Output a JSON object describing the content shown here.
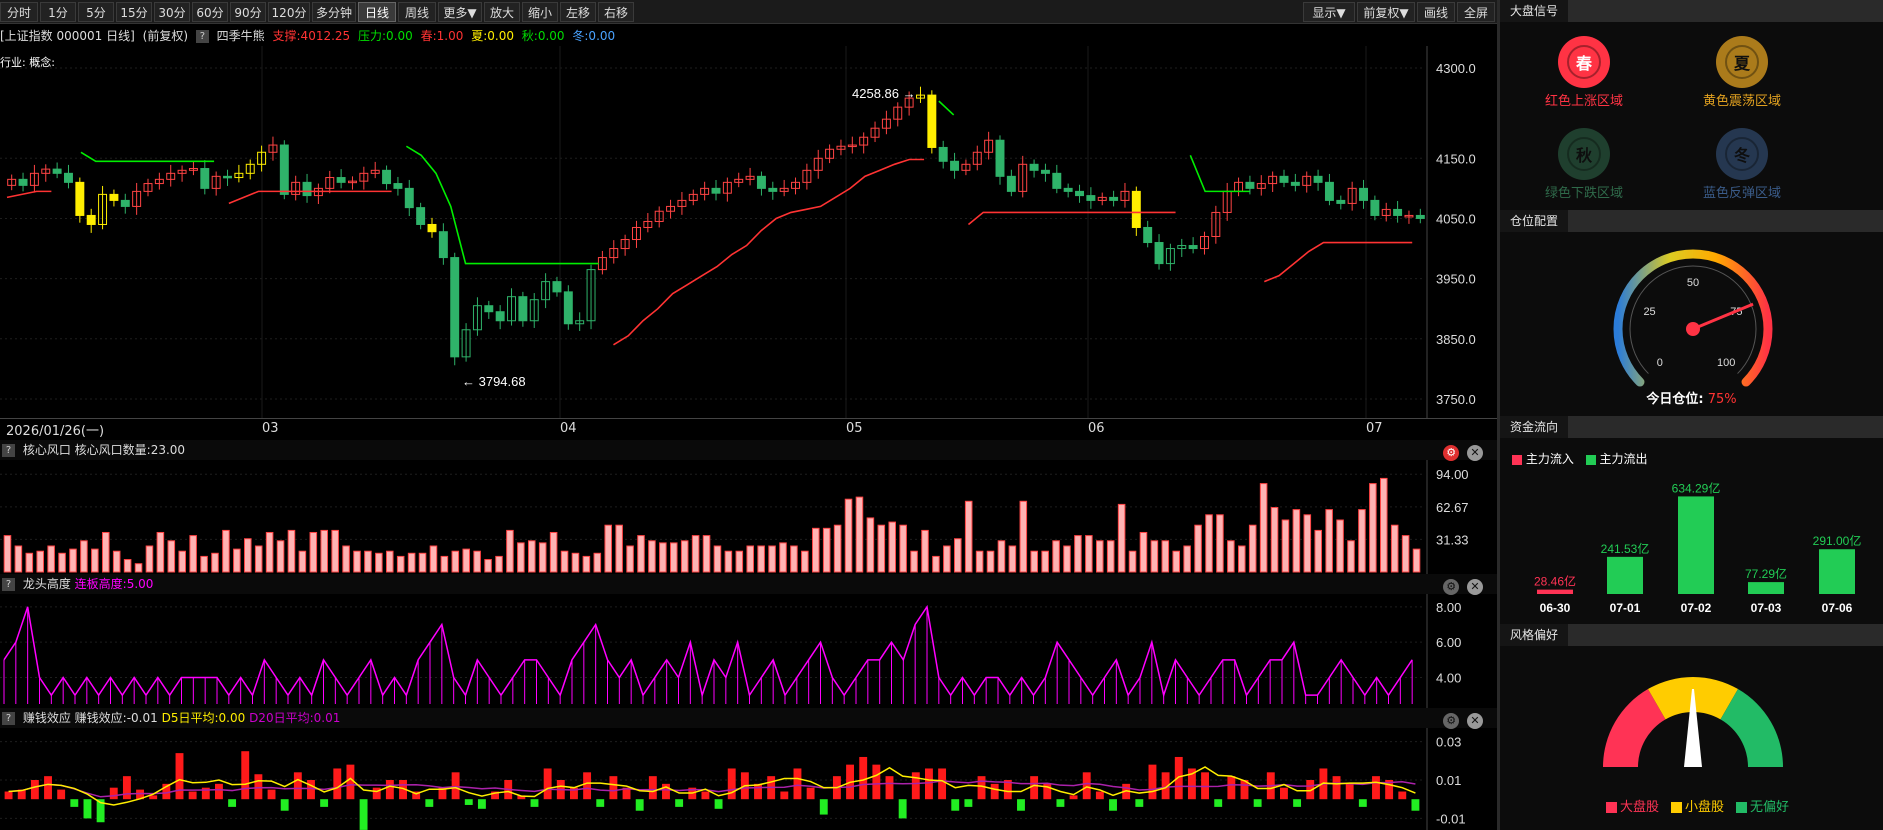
{
  "toolbar": {
    "left_buttons": [
      "分时",
      "1分",
      "5分",
      "15分",
      "30分",
      "60分",
      "90分",
      "120分",
      "多分钟",
      "日线",
      "周线",
      "更多▼",
      "放大",
      "缩小",
      "左移",
      "右移"
    ],
    "active": "日线",
    "right_buttons": [
      "显示▼",
      "前复权▼",
      "画线",
      "全屏"
    ]
  },
  "infobar": {
    "security": "[上证指数 000001 日线]",
    "adjust": "(前复权)",
    "indicator": "四季牛熊",
    "support": "支撑:4012.25",
    "pressure": "压力:0.00",
    "spring": "春:1.00",
    "summer": "夏:0.00",
    "autumn": "秋:0.00",
    "winter": "冬:0.00"
  },
  "main_chart": {
    "industry_label": "行业: 概念:",
    "y_ticks": [
      "4300.0",
      "4150.0",
      "4050.0",
      "3950.0",
      "3850.0",
      "3750.0"
    ],
    "high_label": "4258.86",
    "low_label": "3794.68",
    "date_label": "2026/01/26(一)",
    "month_labels": [
      "03",
      "04",
      "05",
      "06",
      "07"
    ]
  },
  "panel1": {
    "title": "核心风口",
    "value": "核心风口数量:23.00",
    "y_ticks": [
      "94.00",
      "62.67",
      "31.33"
    ]
  },
  "panel2": {
    "title": "龙头高度",
    "value": "连板高度:5.00",
    "y_ticks": [
      "8.00",
      "6.00",
      "4.00"
    ]
  },
  "panel3": {
    "title": "赚钱效应",
    "value": "赚钱效应:-0.01",
    "d5": "D5日平均:0.00",
    "d20": "D20日平均:0.01",
    "y_ticks": [
      "0.03",
      "0.01",
      "-0.01"
    ]
  },
  "side": {
    "market_signal": {
      "title": "大盘信号",
      "zones": [
        {
          "char": "春",
          "label": "红色上涨区域",
          "color": "#ff3344"
        },
        {
          "char": "夏",
          "label": "黄色震荡区域",
          "color": "#e0a020"
        },
        {
          "char": "秋",
          "label": "绿色下跌区域",
          "color": "#2f6a4a"
        },
        {
          "char": "冬",
          "label": "蓝色反弹区域",
          "color": "#3a5b88"
        }
      ]
    },
    "position": {
      "title": "仓位配置",
      "ticks": [
        "0",
        "25",
        "50",
        "75",
        "100"
      ],
      "today_label": "今日仓位:",
      "today_value": "75%",
      "value": 75
    },
    "capital_flow": {
      "title": "资金流向",
      "legend_in": "主力流入",
      "legend_out": "主力流出",
      "bars": [
        {
          "date": "06-30",
          "label": "28.46亿",
          "value": 28.46,
          "type": "in"
        },
        {
          "date": "07-01",
          "label": "241.53亿",
          "value": 241.53,
          "type": "out"
        },
        {
          "date": "07-02",
          "label": "634.29亿",
          "value": 634.29,
          "type": "out"
        },
        {
          "date": "07-03",
          "label": "77.29亿",
          "value": 77.29,
          "type": "out"
        },
        {
          "date": "07-06",
          "label": "291.00亿",
          "value": 291.0,
          "type": "out"
        }
      ]
    },
    "style_pref": {
      "title": "风格偏好",
      "legend": [
        "大盘股",
        "小盘股",
        "无偏好"
      ],
      "colors": [
        "#ff3355",
        "#ffcc00",
        "#22bb66"
      ]
    }
  },
  "colors": {
    "up": "#ff4444",
    "down": "#2fb36a",
    "yellow": "#ffee00",
    "magenta": "#ff00ff"
  },
  "chart_data": [
    {
      "type": "candlestick",
      "title": "四季牛熊",
      "ylim": [
        3730,
        4320
      ],
      "closes": [
        4115,
        4105,
        4125,
        4132,
        4125,
        4110,
        4055,
        4040,
        4090,
        4080,
        4070,
        4095,
        4108,
        4115,
        4125,
        4130,
        4133,
        4100,
        4120,
        4118,
        4125,
        4140,
        4160,
        4172,
        4090,
        4110,
        4088,
        4100,
        4118,
        4110,
        4112,
        4125,
        4130,
        4108,
        4100,
        4068,
        4040,
        4028,
        3985,
        3820,
        3865,
        3905,
        3895,
        3880,
        3920,
        3880,
        3915,
        3945,
        3928,
        3875,
        3880,
        3965,
        3985,
        4000,
        4015,
        4035,
        4045,
        4062,
        4070,
        4080,
        4090,
        4100,
        4092,
        4110,
        4115,
        4120,
        4100,
        4095,
        4100,
        4110,
        4130,
        4150,
        4165,
        4170,
        4172,
        4185,
        4200,
        4215,
        4235,
        4250,
        4255,
        4168,
        4145,
        4130,
        4140,
        4160,
        4180,
        4120,
        4095,
        4140,
        4130,
        4125,
        4100,
        4095,
        4088,
        4080,
        4085,
        4080,
        4095,
        4035,
        4010,
        3975,
        4000,
        4005,
        4000,
        4020,
        4060,
        4095,
        4110,
        4100,
        4108,
        4120,
        4110,
        4105,
        4120,
        4110,
        4080,
        4075,
        4100,
        4080,
        4055,
        4065,
        4055,
        4055,
        4050
      ],
      "line_segments": [
        {
          "color": "#ff3333",
          "points": [
            [
              0,
              4085
            ],
            [
              1,
              4090
            ],
            [
              2,
              4095
            ],
            [
              3,
              4095
            ]
          ]
        },
        {
          "color": "#00ee00",
          "points": [
            [
              5,
              4160
            ],
            [
              6,
              4145
            ],
            [
              7,
              4145
            ],
            [
              8,
              4145
            ],
            [
              9,
              4145
            ],
            [
              10,
              4145
            ],
            [
              11,
              4145
            ],
            [
              12,
              4145
            ],
            [
              13,
              4145
            ],
            [
              14,
              4145
            ]
          ]
        },
        {
          "color": "#ff3333",
          "points": [
            [
              15,
              4075
            ],
            [
              16,
              4085
            ],
            [
              17,
              4095
            ],
            [
              18,
              4095
            ],
            [
              19,
              4095
            ],
            [
              20,
              4095
            ],
            [
              21,
              4095
            ],
            [
              22,
              4095
            ],
            [
              23,
              4095
            ],
            [
              24,
              4095
            ],
            [
              25,
              4095
            ],
            [
              26,
              4095
            ]
          ]
        },
        {
          "color": "#00ee00",
          "points": [
            [
              27,
              4170
            ],
            [
              28,
              4155
            ],
            [
              29,
              4125
            ],
            [
              30,
              4070
            ],
            [
              31,
              3975
            ],
            [
              32,
              3975
            ],
            [
              33,
              3975
            ],
            [
              34,
              3975
            ],
            [
              35,
              3975
            ],
            [
              36,
              3975
            ],
            [
              37,
              3975
            ],
            [
              38,
              3975
            ],
            [
              39,
              3975
            ],
            [
              40,
              3975
            ]
          ]
        },
        {
          "color": "#ff3333",
          "points": [
            [
              41,
              3840
            ],
            [
              42,
              3855
            ],
            [
              43,
              3880
            ],
            [
              44,
              3900
            ],
            [
              45,
              3925
            ],
            [
              46,
              3940
            ],
            [
              47,
              3955
            ],
            [
              48,
              3970
            ],
            [
              49,
              3990
            ],
            [
              50,
              4005
            ],
            [
              51,
              4030
            ],
            [
              52,
              4050
            ],
            [
              53,
              4060
            ],
            [
              54,
              4065
            ],
            [
              55,
              4070
            ],
            [
              56,
              4085
            ],
            [
              57,
              4100
            ],
            [
              58,
              4120
            ],
            [
              59,
              4130
            ],
            [
              60,
              4140
            ],
            [
              61,
              4148
            ],
            [
              62,
              4148
            ]
          ]
        },
        {
          "color": "#00ee00",
          "points": [
            [
              63,
              4245
            ],
            [
              64,
              4222
            ]
          ]
        },
        {
          "color": "#ff3333",
          "points": [
            [
              65,
              4040
            ],
            [
              66,
              4060
            ],
            [
              67,
              4060
            ],
            [
              68,
              4060
            ],
            [
              69,
              4060
            ],
            [
              70,
              4060
            ],
            [
              71,
              4060
            ],
            [
              72,
              4060
            ],
            [
              73,
              4060
            ],
            [
              74,
              4060
            ],
            [
              75,
              4060
            ],
            [
              76,
              4060
            ],
            [
              77,
              4060
            ],
            [
              78,
              4060
            ],
            [
              79,
              4060
            ]
          ]
        },
        {
          "color": "#00ee00",
          "points": [
            [
              80,
              4155
            ],
            [
              81,
              4095
            ],
            [
              82,
              4095
            ],
            [
              83,
              4095
            ],
            [
              84,
              4095
            ]
          ]
        },
        {
          "color": "#ff3333",
          "points": [
            [
              85,
              3945
            ],
            [
              86,
              3955
            ],
            [
              87,
              3975
            ],
            [
              88,
              3995
            ],
            [
              89,
              4010
            ],
            [
              90,
              4010
            ],
            [
              91,
              4010
            ],
            [
              92,
              4010
            ],
            [
              93,
              4010
            ],
            [
              94,
              4010
            ],
            [
              95,
              4010
            ]
          ]
        }
      ]
    },
    {
      "type": "bar",
      "title": "核心风口",
      "ylim": [
        0,
        100
      ],
      "values": [
        35,
        25,
        18,
        20,
        25,
        18,
        22,
        30,
        22,
        38,
        20,
        12,
        8,
        25,
        38,
        30,
        20,
        35,
        15,
        18,
        40,
        22,
        32,
        25,
        38,
        30,
        40,
        20,
        38,
        40,
        40,
        25,
        20,
        20,
        18,
        20,
        15,
        18,
        18,
        25,
        15,
        20,
        22,
        20,
        12,
        15,
        40,
        28,
        30,
        28,
        38,
        20,
        18,
        15,
        18,
        45,
        45,
        25,
        35,
        30,
        28,
        28,
        30,
        35,
        35,
        25,
        20,
        20,
        25,
        25,
        25,
        28,
        25,
        20,
        42,
        42,
        45,
        70,
        72,
        52,
        45,
        48,
        45,
        20,
        40,
        15,
        25,
        32,
        68,
        20,
        20,
        30,
        25,
        68,
        20,
        20,
        30,
        25,
        35,
        35,
        30,
        30,
        65,
        20,
        38,
        30,
        30,
        20,
        25,
        45,
        55,
        55,
        30,
        25,
        45,
        85,
        62,
        50,
        60,
        55,
        40,
        60,
        50,
        30,
        60,
        85,
        90,
        45,
        35,
        22
      ]
    },
    {
      "type": "line",
      "title": "龙头高度",
      "ylim": [
        2.5,
        8.5
      ],
      "values": [
        5,
        6,
        8,
        4,
        3,
        4,
        3,
        4,
        3,
        4,
        3,
        4,
        3,
        4,
        3,
        4,
        4,
        4,
        4,
        3,
        4,
        3,
        5,
        4,
        3,
        4,
        3,
        5,
        4,
        3,
        4,
        5,
        3,
        4,
        3,
        5,
        6,
        7,
        4,
        3,
        5,
        4,
        3,
        4,
        5,
        5,
        4,
        3,
        5,
        6,
        7,
        5,
        4,
        5,
        3,
        4,
        5,
        4,
        6,
        3,
        5,
        4,
        6,
        3,
        4,
        5,
        3,
        4,
        5,
        6,
        4,
        3,
        4,
        5,
        5,
        6,
        5,
        7,
        8,
        4,
        3,
        4,
        3,
        4,
        4,
        3,
        4,
        3,
        4,
        6,
        5,
        4,
        3,
        4,
        5,
        3,
        4,
        6,
        3,
        5,
        4,
        3,
        4,
        5,
        5,
        3,
        4,
        5,
        5,
        6,
        3,
        3,
        4,
        5,
        4,
        3,
        4,
        3,
        4,
        5
      ]
    },
    {
      "type": "bar",
      "title": "赚钱效应",
      "ylim": [
        -0.015,
        0.035
      ],
      "values": [
        0.004,
        0.005,
        0.01,
        0.012,
        0.005,
        -0.004,
        -0.01,
        -0.012,
        0.006,
        0.012,
        0.005,
        0.002,
        0.008,
        0.024,
        0.004,
        0.006,
        0.008,
        -0.004,
        0.025,
        0.013,
        0.005,
        -0.006,
        0.014,
        0.01,
        -0.004,
        0.016,
        0.018,
        -0.016,
        0.006,
        0.01,
        0.01,
        0.004,
        -0.004,
        0.006,
        0.014,
        -0.003,
        -0.005,
        0.004,
        0.01,
        0.002,
        -0.004,
        0.016,
        0.01,
        0.006,
        0.014,
        -0.004,
        0.012,
        0.006,
        -0.006,
        0.012,
        0.008,
        -0.004,
        0.006,
        0.004,
        -0.005,
        0.016,
        0.014,
        0.008,
        0.012,
        0.004,
        0.016,
        0.006,
        -0.008,
        0.012,
        0.018,
        0.022,
        0.018,
        0.012,
        -0.01,
        0.014,
        0.016,
        0.016,
        -0.006,
        -0.004,
        0.012,
        0.008,
        0.01,
        -0.006,
        0.012,
        0.008,
        -0.004,
        0.002,
        0.014,
        0.004,
        -0.006,
        0.008,
        -0.004,
        0.018,
        0.014,
        0.022,
        0.016,
        0.014,
        -0.004,
        0.012,
        0.01,
        -0.004,
        0.014,
        0.006,
        -0.004,
        0.01,
        0.016,
        0.012,
        0.008,
        -0.004,
        0.012,
        0.01,
        0.004,
        -0.006
      ]
    }
  ]
}
